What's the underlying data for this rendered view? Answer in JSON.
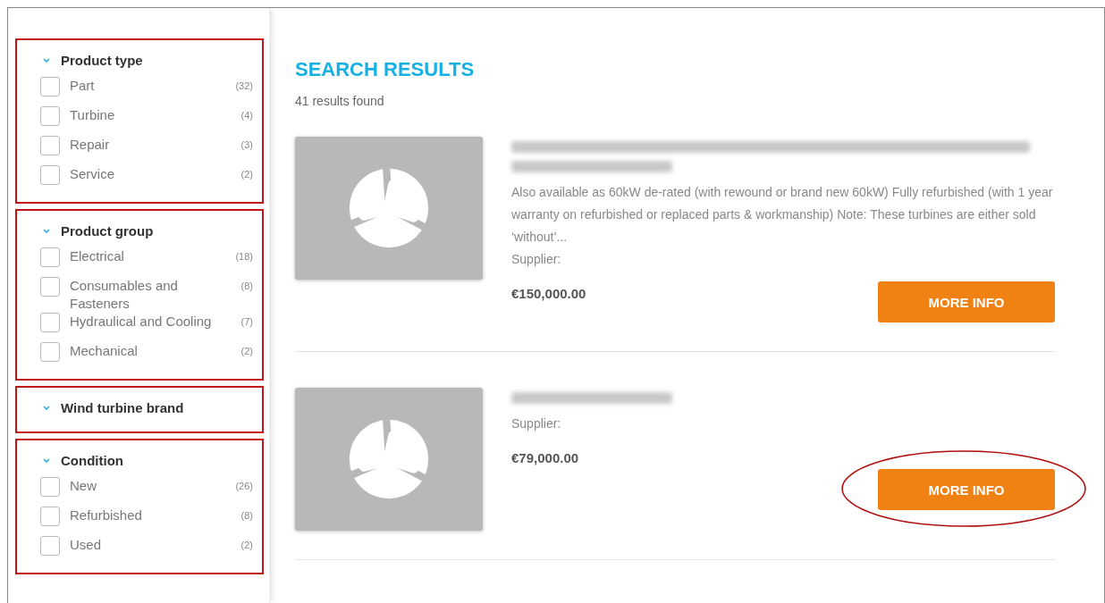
{
  "filters": [
    {
      "title": "Product type",
      "expanded": true,
      "highlighted": true,
      "options": [
        {
          "label": "Part",
          "count": "(32)",
          "checked": false
        },
        {
          "label": "Turbine",
          "count": "(4)",
          "checked": false
        },
        {
          "label": "Repair",
          "count": "(3)",
          "checked": false
        },
        {
          "label": "Service",
          "count": "(2)",
          "checked": false
        }
      ]
    },
    {
      "title": "Product group",
      "expanded": true,
      "highlighted": true,
      "options": [
        {
          "label": "Electrical",
          "count": "(18)",
          "checked": false
        },
        {
          "label": "Consumables and Fasteners",
          "count": "(8)",
          "checked": false
        },
        {
          "label": "Hydraulical and Cooling",
          "count": "(7)",
          "checked": false
        },
        {
          "label": "Mechanical",
          "count": "(2)",
          "checked": false
        }
      ]
    },
    {
      "title": "Wind turbine brand",
      "expanded": true,
      "highlighted": true
    },
    {
      "title": "Condition",
      "expanded": true,
      "highlighted": true,
      "options": [
        {
          "label": "New",
          "count": "(26)",
          "checked": false
        },
        {
          "label": "Refurbished",
          "count": "(8)",
          "checked": false
        },
        {
          "label": "Used",
          "count": "(2)",
          "checked": false
        }
      ]
    }
  ],
  "heading": "SEARCH RESULTS",
  "results_count": "41 results found",
  "results": [
    {
      "kind": "twoline",
      "description": "Also available as 60kW de-rated (with rewound or brand new 60kW) Fully refurbished (with 1 year warranty on refurbished or replaced parts & workmanship) Note: These turbines are either sold ‘without’...",
      "supplier": "Supplier:",
      "price": "€150,000.00",
      "button": "MORE INFO",
      "circled": false
    },
    {
      "kind": "oneline",
      "supplier": "Supplier:",
      "price": "€79,000.00",
      "button": "MORE INFO",
      "circled": true
    }
  ]
}
